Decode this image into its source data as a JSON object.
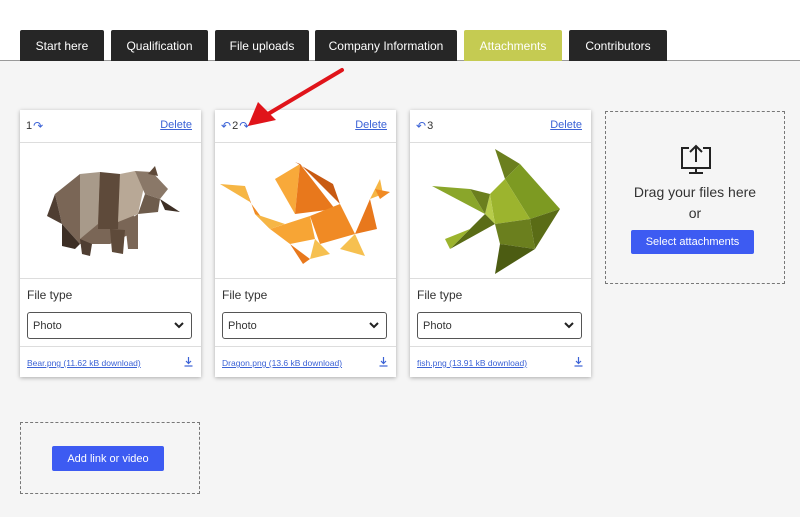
{
  "tabs": [
    {
      "label": "Start here"
    },
    {
      "label": "Qualification"
    },
    {
      "label": "File uploads"
    },
    {
      "label": "Company Information"
    },
    {
      "label": "Attachments",
      "active": true
    },
    {
      "label": "Contributors"
    }
  ],
  "cards": [
    {
      "order": "1",
      "delete_label": "Delete",
      "subject": "bear",
      "file_type_label": "File type",
      "file_type_value": "Photo",
      "download_label": "Bear.png (11.62 kB download)"
    },
    {
      "order": "2",
      "delete_label": "Delete",
      "subject": "dragon",
      "file_type_label": "File type",
      "file_type_value": "Photo",
      "download_label": "Dragon.png (13.6 kB download)"
    },
    {
      "order": "3",
      "delete_label": "Delete",
      "subject": "fish",
      "file_type_label": "File type",
      "file_type_value": "Photo",
      "download_label": "fish.png (13.91 kB download)"
    }
  ],
  "dropzone": {
    "icon": "upload-monitor-icon",
    "line1": "Drag your files here",
    "line2": "or",
    "button_label": "Select attachments"
  },
  "link_zone": {
    "button_label": "Add link or video"
  },
  "colors": {
    "tab_bg": "#262626",
    "tab_active": "#c5cb52",
    "button_blue": "#3d5bf2",
    "link_blue": "#3b62d6",
    "annotation_red": "#e0141a"
  }
}
